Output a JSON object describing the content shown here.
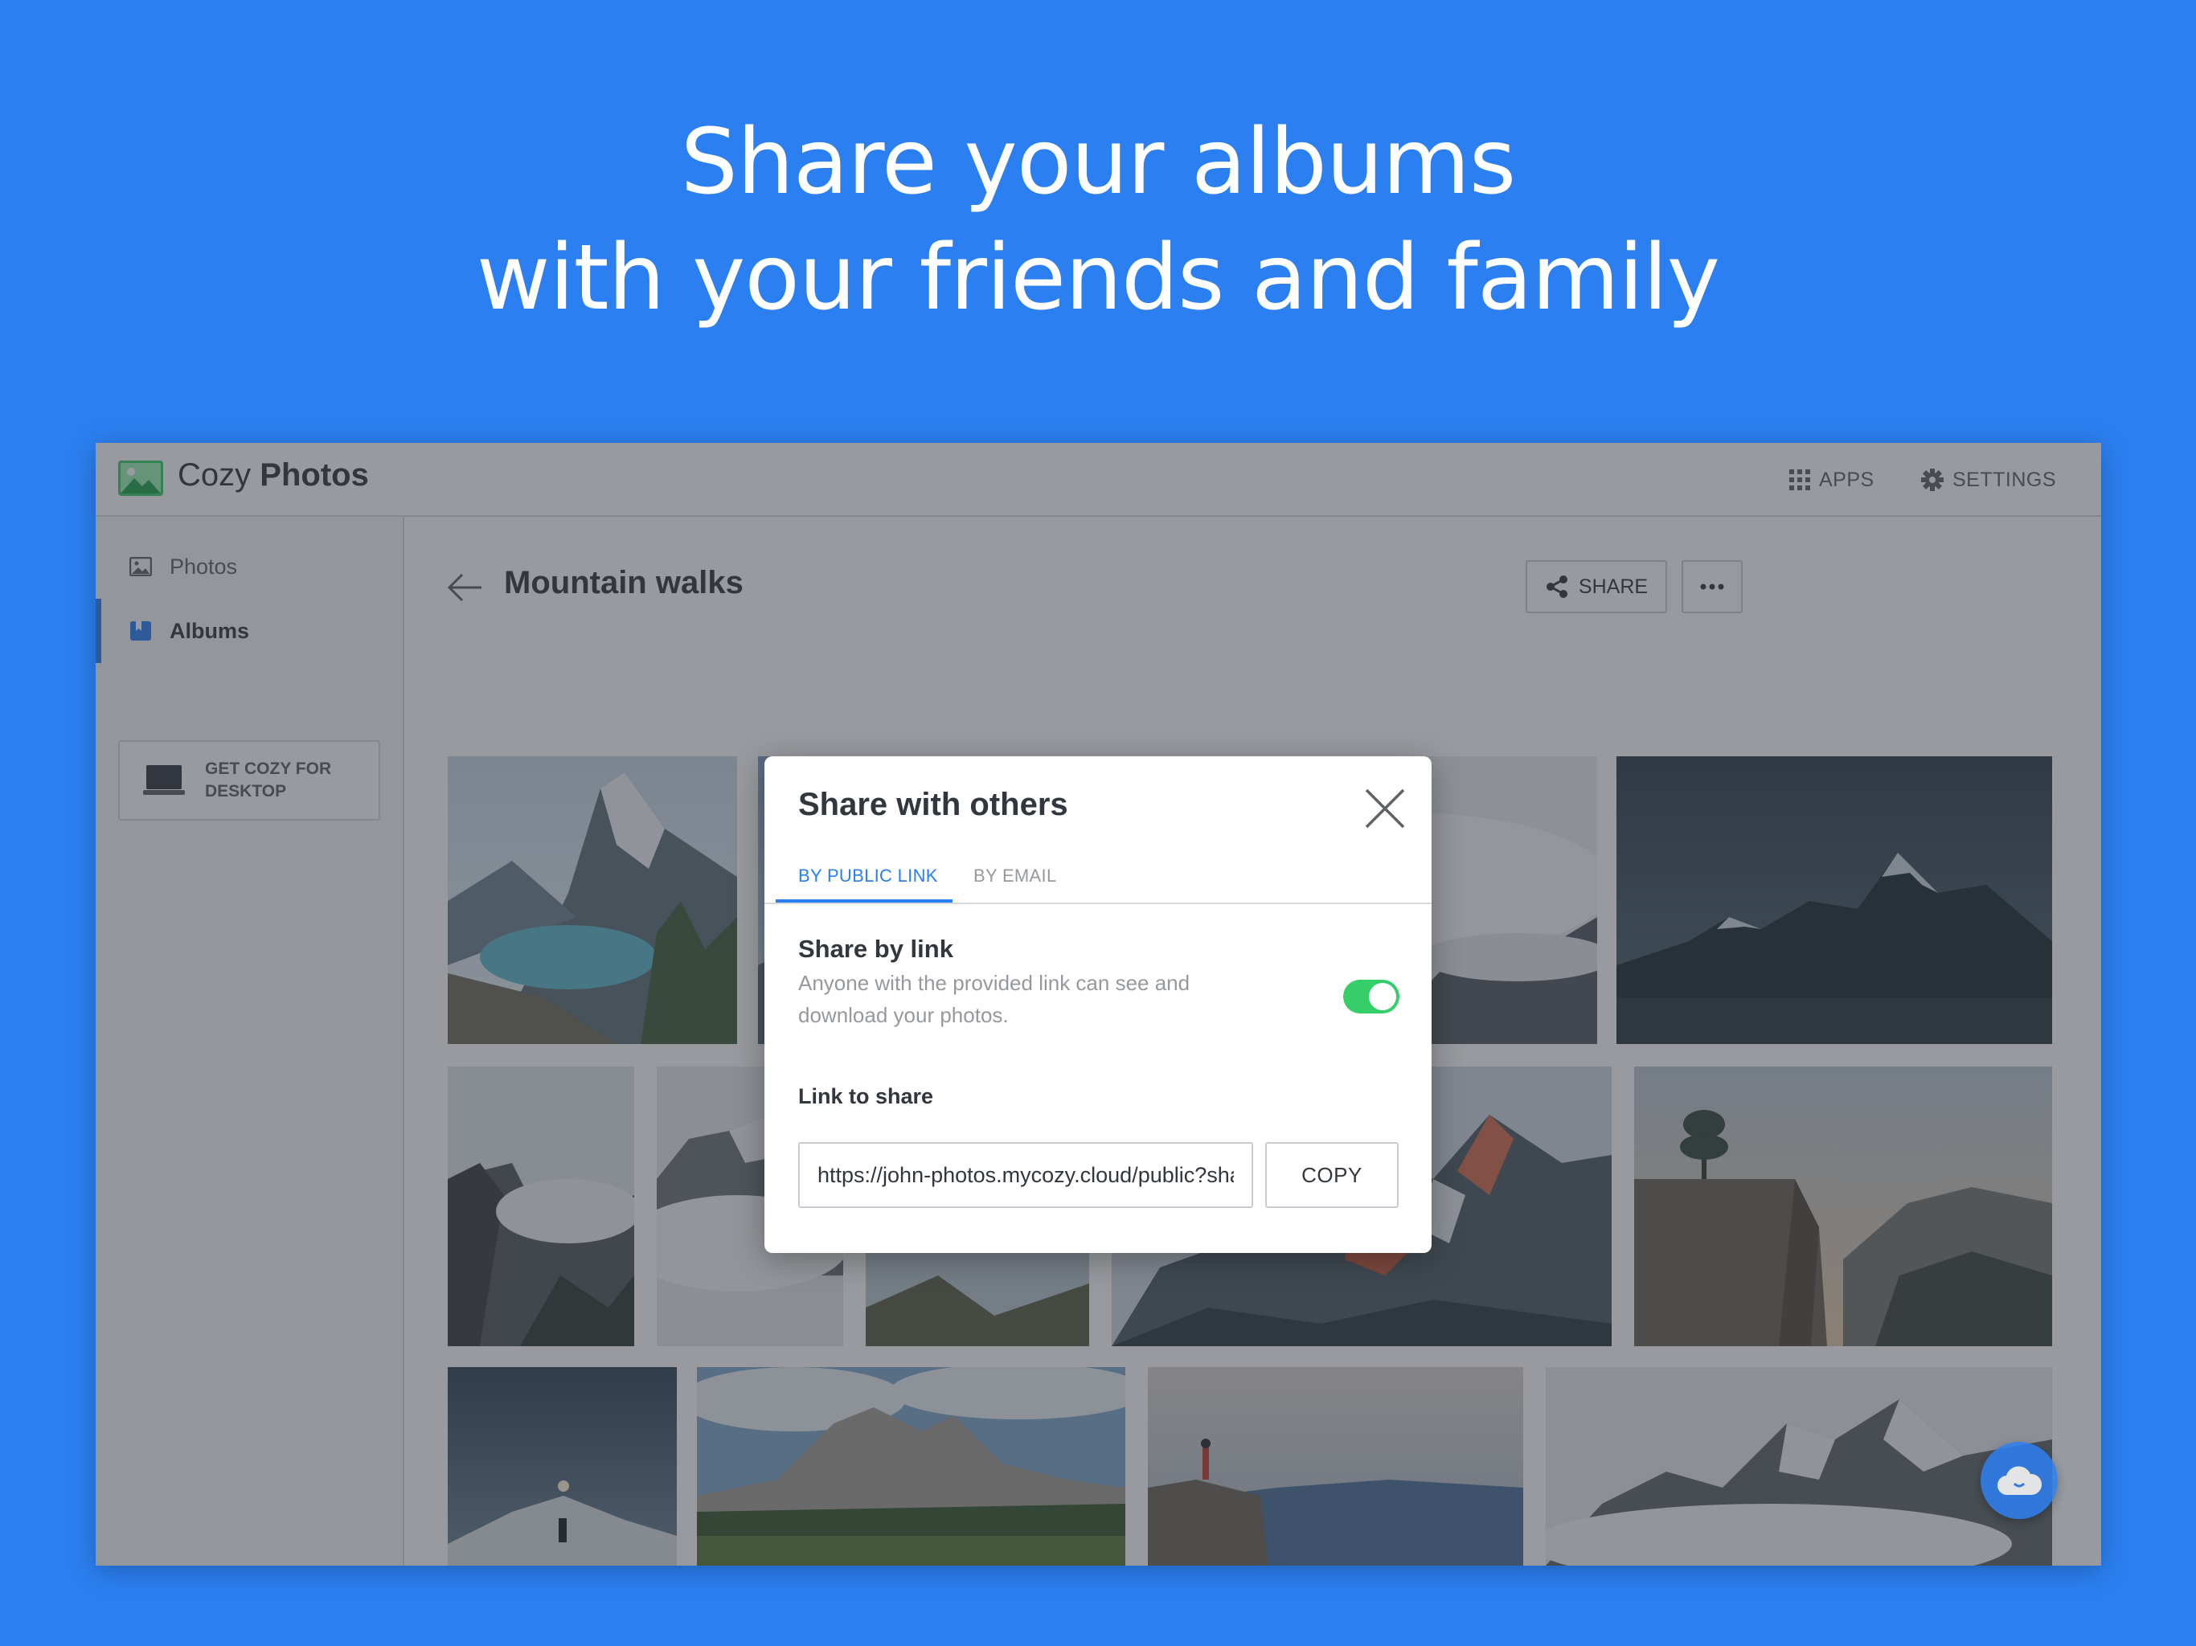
{
  "hero": {
    "line1": "Share your albums",
    "line2": "with your friends and family"
  },
  "app": {
    "title_light": "Cozy",
    "title_bold": "Photos",
    "top_apps": "APPS",
    "top_settings": "SETTINGS"
  },
  "sidebar": {
    "items": [
      {
        "label": "Photos",
        "icon": "image-icon",
        "active": false
      },
      {
        "label": "Albums",
        "icon": "album-icon",
        "active": true
      }
    ],
    "desktop_card": "GET COZY FOR DESKTOP"
  },
  "album": {
    "title": "Mountain walks",
    "share_label": "SHARE"
  },
  "modal": {
    "title": "Share with others",
    "tabs": [
      {
        "label": "BY PUBLIC LINK",
        "active": true
      },
      {
        "label": "BY EMAIL",
        "active": false
      }
    ],
    "share_title": "Share by link",
    "share_desc": "Anyone with the provided link can see and download your photos.",
    "toggle_on": true,
    "link_label": "Link to share",
    "link_value": "https://john-photos.mycozy.cloud/public?sharecode=",
    "copy_label": "COPY"
  },
  "colors": {
    "background": "#2c7ff1",
    "accent": "#297ef2",
    "toggle": "#35ce68",
    "text": "#32363f"
  }
}
